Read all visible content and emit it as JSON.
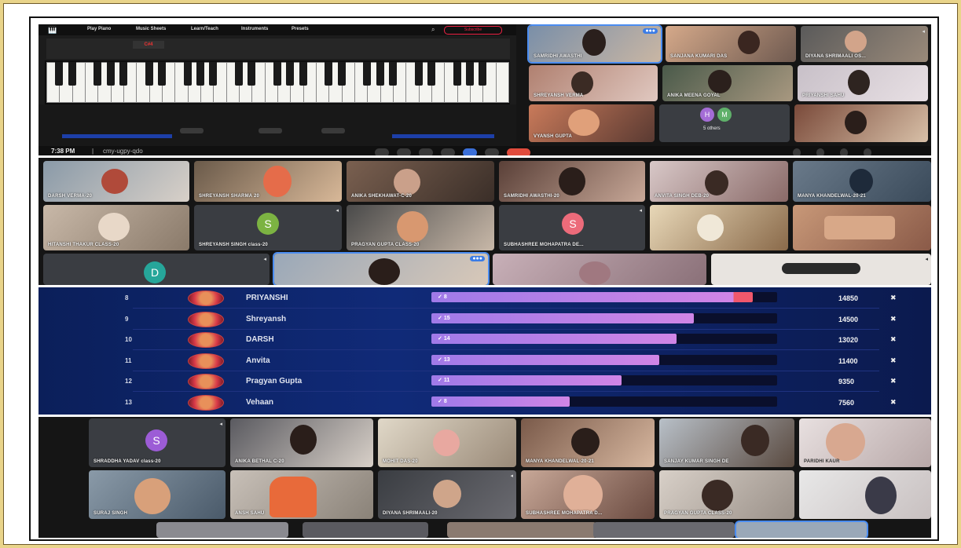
{
  "piano_app": {
    "logo": "🎹",
    "menu": [
      "Play Piano",
      "Music Sheets",
      "Learn/Teach",
      "Instruments",
      "Presets"
    ],
    "subscribe": "Subscribe",
    "note": "C#4",
    "search_icon": "search-icon"
  },
  "status_bar": {
    "time": "7:38 PM",
    "separator": "|",
    "meet_code": "cmy-ugpy-qdo"
  },
  "meet_top": {
    "others_count": "5 others",
    "others_initials": [
      "H",
      "M"
    ],
    "tiles": [
      {
        "name": "SAMRIDHI AWASTHI",
        "active": true
      },
      {
        "name": "SANJANA KUMARI DAS",
        "active": false
      },
      {
        "name": "DIYANA SHRIMAALI OS...",
        "active": false
      },
      {
        "name": "SHREYANSH VERMA",
        "active": false
      },
      {
        "name": "ANIKA MEENA GOYAL",
        "active": false
      },
      {
        "name": "PRIYANSHI SAHU",
        "active": false
      },
      {
        "name": "VYANSH GUPTA",
        "active": false
      },
      {
        "name": "",
        "active": false
      }
    ]
  },
  "meet_mid": {
    "tiles": [
      {
        "name": "DARSH VERMA-20"
      },
      {
        "name": "SHREYANSH SHARMA 20"
      },
      {
        "name": "ANIKA SHEKHAWAT-C-20"
      },
      {
        "name": "SAMRIDHI AWASTHI-20"
      },
      {
        "name": "ANVITA SINGH DEB-20"
      },
      {
        "name": "MANYA KHANDELWAL-20-21"
      },
      {
        "name": "HITANSHI THAKUR CLASS-20"
      },
      {
        "name": "SHREYANSH SINGH class-20",
        "initial": "S",
        "color": "#7cb342"
      },
      {
        "name": "PRAGYAN GUPTA CLASS-20"
      },
      {
        "name": "SUBHASHREE MOHAPATRA DE...",
        "initial": "S",
        "color": "#ec6b7a"
      },
      {
        "name": "",
        "initial": "D",
        "color": "#26a69a"
      }
    ]
  },
  "leaderboard": {
    "rows": [
      {
        "rank": "8",
        "name": "PRIYANSHI",
        "correct": "8",
        "score": "14850",
        "fraction": 0.93
      },
      {
        "rank": "9",
        "name": "Shreyansh",
        "correct": "15",
        "score": "14500",
        "fraction": 0.76
      },
      {
        "rank": "10",
        "name": "DARSH",
        "correct": "14",
        "score": "13020",
        "fraction": 0.71
      },
      {
        "rank": "11",
        "name": "Anvita",
        "correct": "13",
        "score": "11400",
        "fraction": 0.66
      },
      {
        "rank": "12",
        "name": "Pragyan Gupta",
        "correct": "11",
        "score": "9350",
        "fraction": 0.55
      },
      {
        "rank": "13",
        "name": "Vehaan",
        "correct": "8",
        "score": "7560",
        "fraction": 0.4
      }
    ],
    "accent": "#c78ae6",
    "highlight": "#f0586c"
  },
  "meet_bottom": {
    "tiles": [
      {
        "name": "SHRADDHA YADAV class-20",
        "initial": "S",
        "color": "#9c5cd6"
      },
      {
        "name": "ANIKA BETHAL C-20"
      },
      {
        "name": "MOHIT DAS-20"
      },
      {
        "name": "MANYA KHANDELWAL-20-21"
      },
      {
        "name": "SANJAY KUMAR SINGH DE"
      },
      {
        "name": "PARIDHI KAUR"
      },
      {
        "name": "SURAJ SINGH"
      },
      {
        "name": "ANSH SAHU"
      },
      {
        "name": "DIYANA SHRIMAALI-20"
      },
      {
        "name": "SUBHASHREE MOHAPATRA D..."
      },
      {
        "name": "PRAGYAN GUPTA CLASS-20"
      },
      {
        "name": ""
      }
    ]
  }
}
